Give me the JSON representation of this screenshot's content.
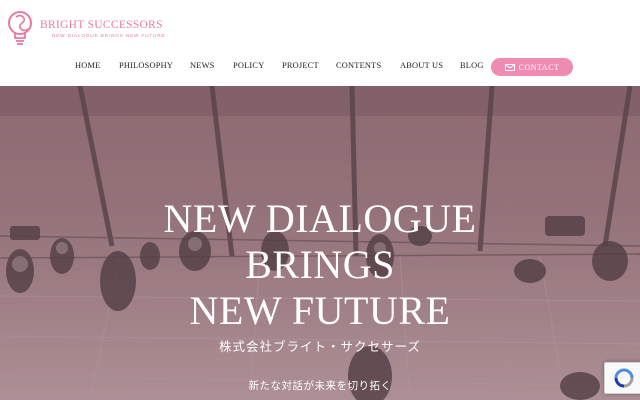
{
  "brand": {
    "name": "BRIGHT SUCCESSORS",
    "sub": "NEW DIALOGUE BRINGS NEW FUTURE",
    "color": "#e87aa2"
  },
  "nav": {
    "items": [
      {
        "label": "HOME"
      },
      {
        "label": "PHILOSOPHY"
      },
      {
        "label": "NEWS"
      },
      {
        "label": "POLICY"
      },
      {
        "label": "PROJECT"
      },
      {
        "label": "CONTENTS"
      },
      {
        "label": "ABOUT US"
      },
      {
        "label": "BLOG"
      }
    ],
    "contact_label": "CONTACT",
    "contact_color": "#f08bb2"
  },
  "hero": {
    "headline": [
      "NEW DIALOGUE",
      "BRINGS",
      "NEW FUTURE"
    ],
    "company": "株式会社ブライト・サクセサーズ",
    "tagline": "新たな対話が未来を切り拓く",
    "overlay_color": "#967076"
  },
  "icons": {
    "logo": "lightbulb-logo-icon",
    "contact": "mail-icon",
    "recaptcha": "recaptcha-icon"
  }
}
